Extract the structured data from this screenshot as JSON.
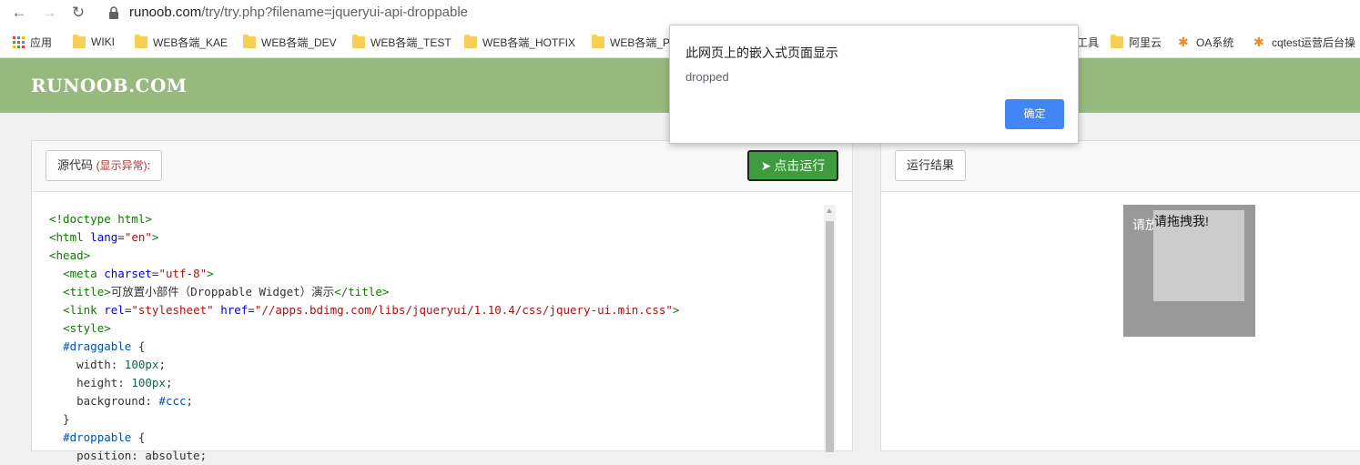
{
  "browser": {
    "url_host": "runoob.com",
    "url_path": "/try/try.php?filename=jqueryui-api-droppable"
  },
  "bookmarks": {
    "apps": "应用",
    "items": [
      "WIKI",
      "WEB各端_KAE",
      "WEB各端_DEV",
      "WEB各端_TEST",
      "WEB各端_HOTFIX",
      "WEB各端_P",
      "工具",
      "阿里云",
      "OA系统",
      "cqtest运营后台操"
    ]
  },
  "header": {
    "logo": "RUNOOB.COM"
  },
  "editor": {
    "source_label": "源代码",
    "source_warning": "(显示异常)",
    "source_colon": ":",
    "run_label": "点击运行"
  },
  "result": {
    "label": "运行结果",
    "droppable_text": "请放",
    "draggable_text": "请拖拽我!"
  },
  "dialog": {
    "title": "此网页上的嵌入式页面显示",
    "message": "dropped",
    "ok_label": "确定"
  },
  "colors": {
    "header_green": "#96b97d",
    "run_green": "#3e9b3e",
    "dialog_blue": "#4285f4"
  }
}
